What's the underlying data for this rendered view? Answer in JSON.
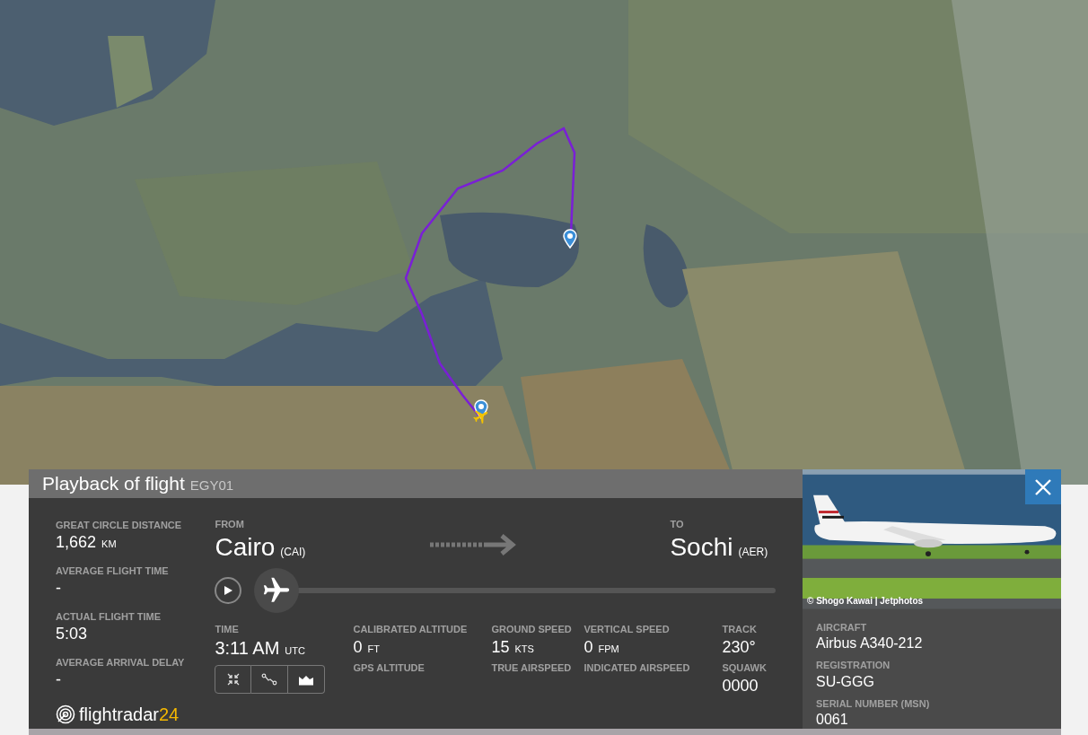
{
  "header": {
    "title": "Playback of flight",
    "flight": "EGY01"
  },
  "stats": [
    {
      "label": "GREAT CIRCLE DISTANCE",
      "value": "1,662",
      "unit": "KM"
    },
    {
      "label": "AVERAGE FLIGHT TIME",
      "value": "-"
    },
    {
      "label": "ACTUAL FLIGHT TIME",
      "value": "5:03"
    },
    {
      "label": "AVERAGE ARRIVAL DELAY",
      "value": "-"
    }
  ],
  "logo": {
    "name": "flightradar",
    "suffix": "24"
  },
  "route": {
    "from": {
      "label": "FROM",
      "city": "Cairo",
      "code": "(CAI)"
    },
    "to": {
      "label": "TO",
      "city": "Sochi",
      "code": "(AER)"
    }
  },
  "playback": {
    "level": 0
  },
  "readings": [
    {
      "label": "TIME",
      "value": "3:11 AM",
      "unit": "UTC",
      "kind": "tools"
    },
    {
      "label": "CALIBRATED ALTITUDE",
      "value": "0",
      "unit": "FT",
      "sub_label": "GPS ALTITUDE",
      "kind": "plain"
    },
    {
      "label": "GROUND SPEED",
      "value": "15",
      "unit": "KTS",
      "sub_label": "TRUE AIRSPEED",
      "kind": "plain"
    },
    {
      "label": "VERTICAL SPEED",
      "value": "0",
      "unit": "FPM",
      "sub_label": "INDICATED AIRSPEED",
      "kind": "plain"
    },
    {
      "label": "TRACK",
      "value": "230°",
      "sub_label": "SQUAWK",
      "sub_value": "0000",
      "kind": "plain"
    }
  ],
  "photo": {
    "credit": "© Shogo Kawai | Jetphotos"
  },
  "aircraft": [
    {
      "label": "AIRCRAFT",
      "value": "Airbus A340-212"
    },
    {
      "label": "REGISTRATION",
      "value": "SU-GGG"
    },
    {
      "label": "SERIAL NUMBER (MSN)",
      "value": "0061"
    }
  ]
}
